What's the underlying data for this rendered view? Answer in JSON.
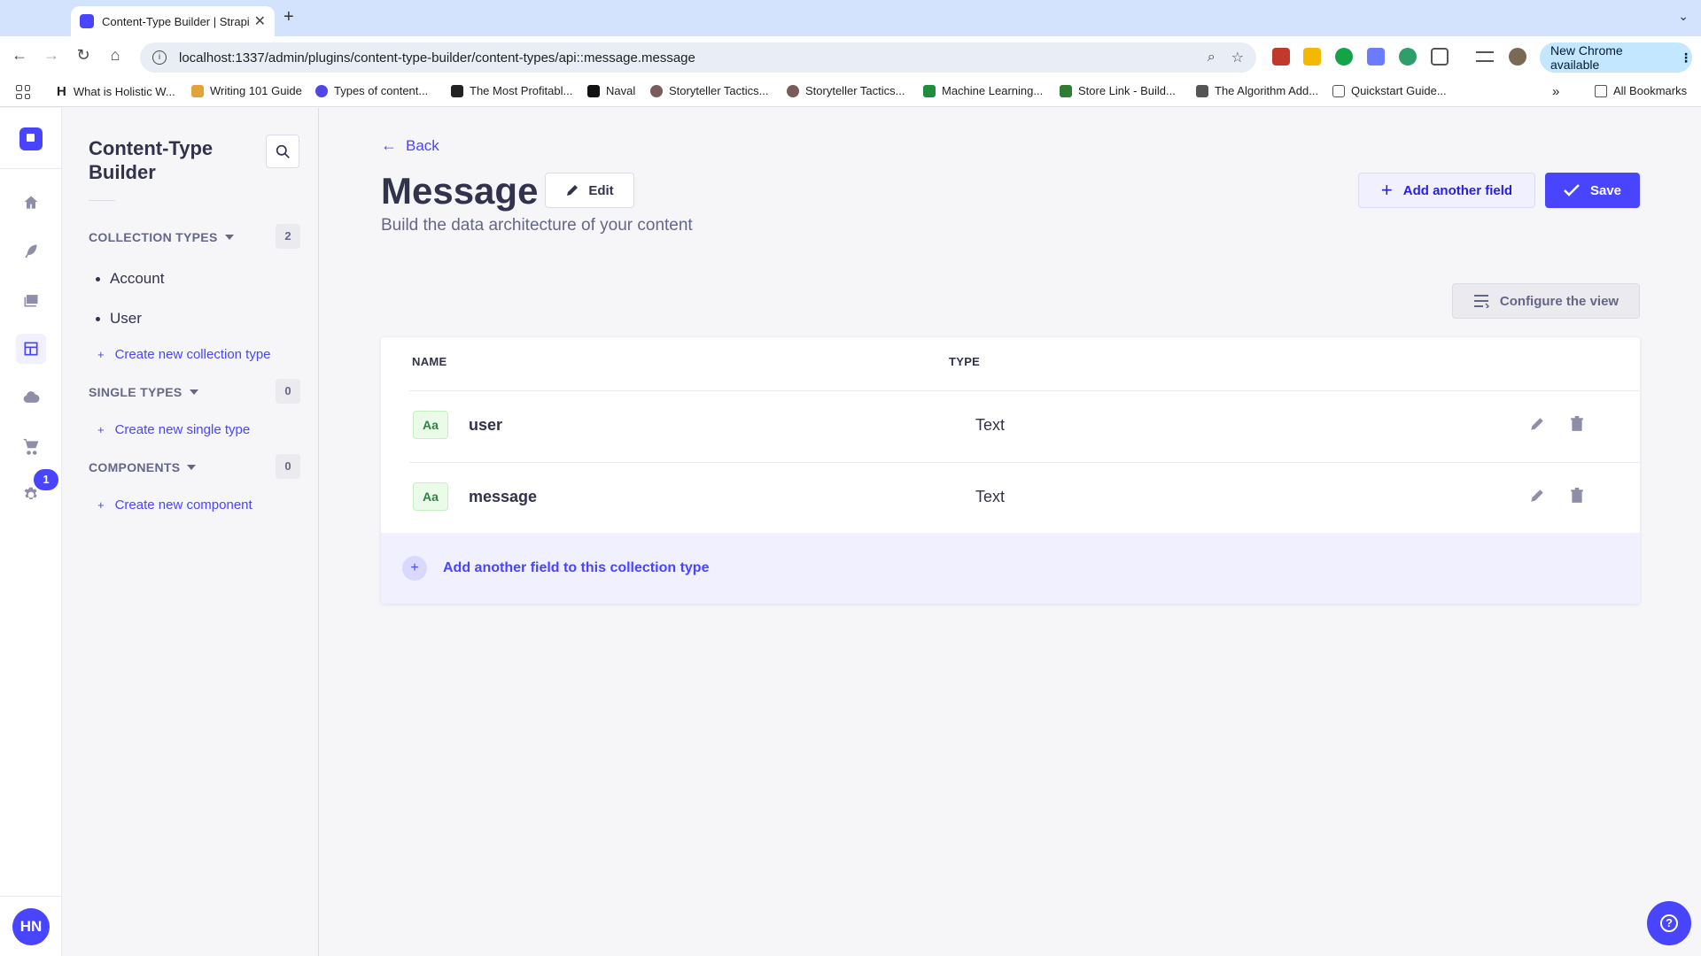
{
  "browser": {
    "tab_title": "Content-Type Builder | Strapi",
    "url": "localhost:1337/admin/plugins/content-type-builder/content-types/api::message.message",
    "update_label": "New Chrome available",
    "bookmarks": [
      "What is Holistic W...",
      "Writing 101 Guide",
      "Types of content...",
      "The Most Profitabl...",
      "Naval",
      "Storyteller Tactics...",
      "Storyteller Tactics...",
      "Machine Learning...",
      "Store Link - Build...",
      "The Algorithm Add...",
      "Quickstart Guide..."
    ],
    "all_bookmarks": "All Bookmarks"
  },
  "mainnav": {
    "notification_count": "1",
    "user_initials": "HN"
  },
  "subnav": {
    "title": "Content-Type Builder",
    "sections": {
      "collection": {
        "title": "COLLECTION TYPES",
        "count": "2",
        "items": [
          "Account",
          "User"
        ],
        "create": "Create new collection type"
      },
      "single": {
        "title": "SINGLE TYPES",
        "count": "0",
        "create": "Create new single type"
      },
      "components": {
        "title": "COMPONENTS",
        "count": "0",
        "create": "Create new component"
      }
    }
  },
  "header": {
    "back": "Back",
    "title": "Message",
    "edit": "Edit",
    "subtitle": "Build the data architecture of your content",
    "add_field": "Add another field",
    "save": "Save",
    "configure": "Configure the view"
  },
  "table": {
    "columns": {
      "name": "NAME",
      "type": "TYPE"
    },
    "rows": [
      {
        "icon": "Aa",
        "name": "user",
        "type": "Text"
      },
      {
        "icon": "Aa",
        "name": "message",
        "type": "Text"
      }
    ],
    "add_footer": "Add another field to this collection type"
  },
  "colors": {
    "primary": "#4945ff",
    "text_field_badge": "#328048"
  }
}
